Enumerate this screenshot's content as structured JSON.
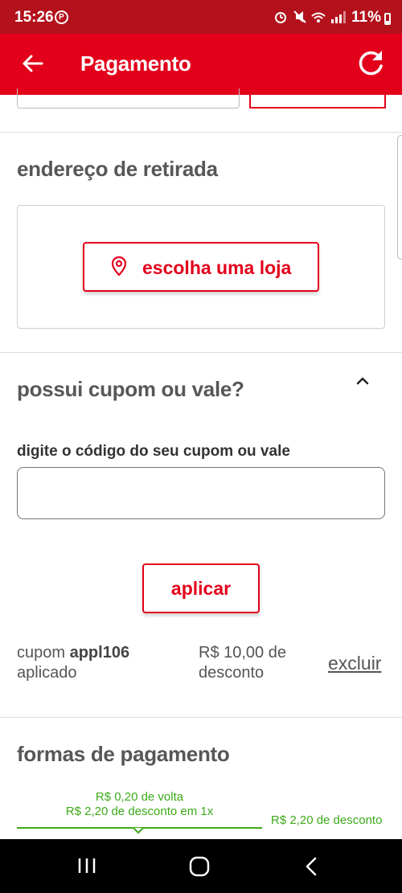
{
  "status_bar": {
    "time": "15:26",
    "notification_badge": "Ⓟ",
    "system_icons": "⏰ 🔇 📶",
    "battery": "11%"
  },
  "app_bar": {
    "title": "Pagamento",
    "back_icon": "arrow-left-icon",
    "refresh_icon": "refresh-icon"
  },
  "pickup": {
    "title": "endereço de retirada",
    "choose_store_label": "escolha uma loja",
    "pin_icon": "map-pin-icon"
  },
  "coupon": {
    "title": "possui cupom ou vale?",
    "field_label": "digite o código do seu cupom ou vale",
    "input_value": "",
    "apply_label": "aplicar",
    "applied_prefix": "cupom ",
    "applied_code": "appl106",
    "applied_suffix": "aplicado",
    "discount_line1": "R$ 10,00 de",
    "discount_line2": "desconto",
    "remove_label": "excluir"
  },
  "payment": {
    "title": "formas de pagamento",
    "option1_line1": "R$ 0,20 de volta",
    "option1_line2": "R$ 2,20 de desconto em 1x",
    "option2_line1": "R$ 2,20 de desconto"
  },
  "colors": {
    "brand_red": "#e3001b",
    "status_red": "#b3111c",
    "promo_green": "#3daa1a"
  }
}
